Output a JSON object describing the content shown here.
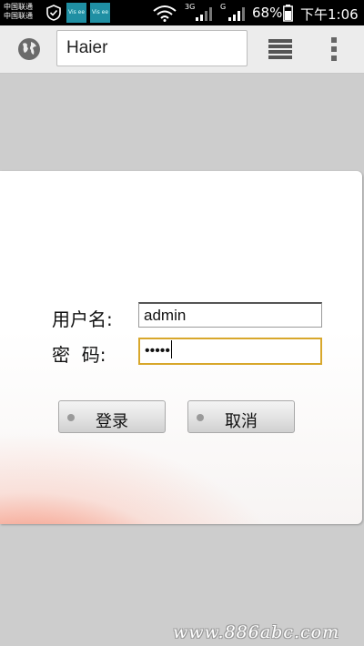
{
  "status_bar": {
    "carrier_line1": "中国联通",
    "carrier_line2": "中国联通",
    "network_3g": "3G",
    "network_g": "G",
    "battery_percent": "68%",
    "time": "下午1:06",
    "app_icon_text": "Vis ee"
  },
  "browser": {
    "url_text": "Haier"
  },
  "login": {
    "username_label": "用户名:",
    "password_label": "密  码:",
    "username_value": "admin",
    "password_value": "•••••",
    "login_button": "登录",
    "cancel_button": "取消"
  },
  "watermark": "www.886abc.com",
  "colors": {
    "focus_border": "#d8a72b",
    "gradient_red": "#f04628"
  }
}
